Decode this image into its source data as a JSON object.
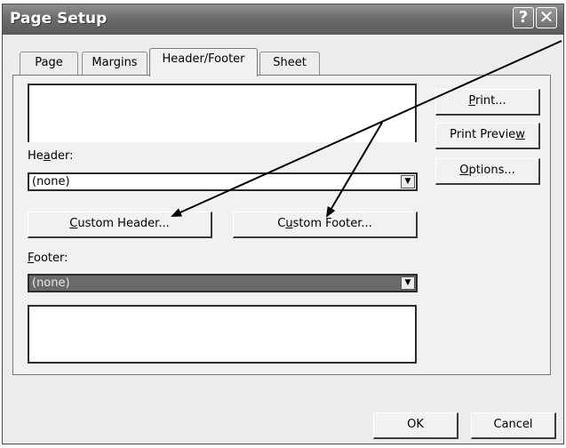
{
  "window": {
    "title": "Page Setup",
    "help_glyph": "?",
    "close_glyph": "✕"
  },
  "tabs": [
    {
      "label": "Page",
      "active": false
    },
    {
      "label": "Margins",
      "active": false
    },
    {
      "label": "Header/Footer",
      "active": true
    },
    {
      "label": "Sheet",
      "active": false
    }
  ],
  "header": {
    "label_pre": "He",
    "label_key": "a",
    "label_post": "der:",
    "value": "(none)"
  },
  "footer": {
    "label_pre": "",
    "label_key": "F",
    "label_post": "ooter:",
    "value": "(none)"
  },
  "buttons": {
    "custom_header": {
      "pre": "",
      "key": "C",
      "post": "ustom Header..."
    },
    "custom_footer": {
      "pre": "C",
      "key": "u",
      "post": "stom Footer..."
    },
    "print": {
      "pre": "",
      "key": "P",
      "post": "rint..."
    },
    "print_preview": {
      "pre": "Print Previe",
      "key": "w",
      "post": ""
    },
    "options": {
      "pre": "",
      "key": "O",
      "post": "ptions..."
    },
    "ok": "OK",
    "cancel": "Cancel"
  },
  "icons": {
    "dropdown": "▼"
  }
}
